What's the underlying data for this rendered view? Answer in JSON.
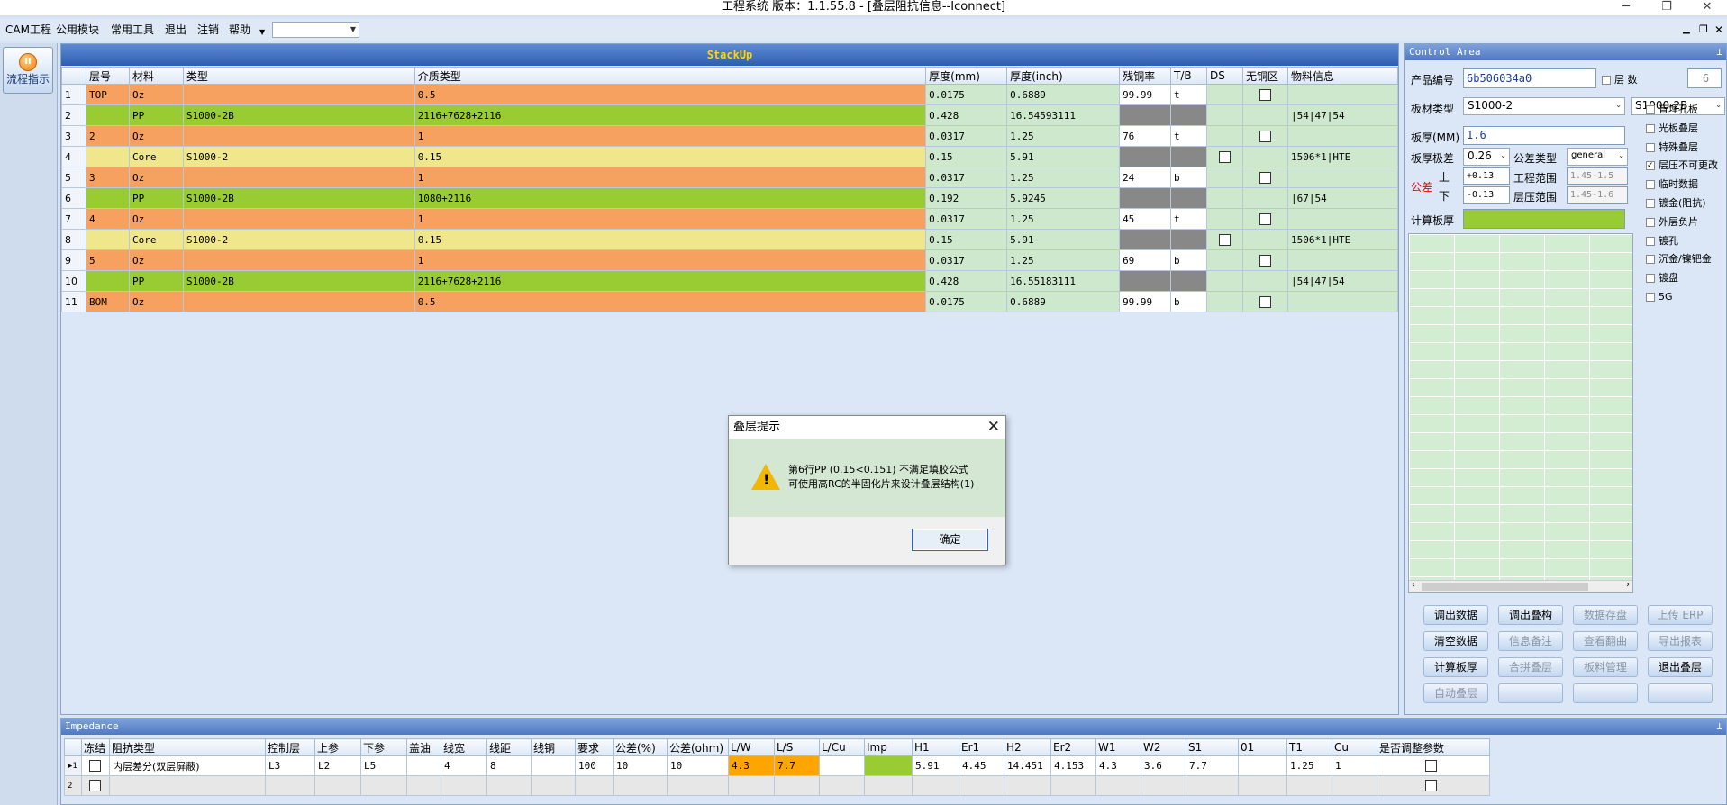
{
  "window": {
    "title": "工程系统   版本：1.1.55.8 - [叠层阻抗信息--Iconnect]"
  },
  "menu": {
    "items": [
      "CAM工程",
      "公用模块",
      "常用工具",
      "退出",
      "注销",
      "帮助"
    ],
    "combo_value": ""
  },
  "left": {
    "flow_label": "流程指示"
  },
  "stackup": {
    "title": "StackUp",
    "headers": [
      "层号",
      "材料",
      "类型",
      "介质类型",
      "厚度(mm)",
      "厚度(inch)",
      "残铜率",
      "T/B",
      "DS",
      "无铜区",
      "物料信息"
    ],
    "rows": [
      {
        "n": "1",
        "layer": "TOP",
        "mat": "Oz",
        "type": "",
        "dielectric": "0.5",
        "mm": "0.0175",
        "inch": "0.6889",
        "cu": "99.99",
        "tb": "t",
        "info": ""
      },
      {
        "n": "2",
        "layer": "",
        "mat": "PP",
        "type": "S1000-2B",
        "dielectric": "2116+7628+2116",
        "mm": "0.428",
        "inch": "16.54593111",
        "cu": "",
        "tb": "",
        "info": "|54|47|54"
      },
      {
        "n": "3",
        "layer": "2",
        "mat": "Oz",
        "type": "",
        "dielectric": "1",
        "mm": "0.0317",
        "inch": "1.25",
        "cu": "76",
        "tb": "t",
        "info": ""
      },
      {
        "n": "4",
        "layer": "",
        "mat": "Core",
        "type": "S1000-2",
        "dielectric": "0.15",
        "mm": "0.15",
        "inch": "5.91",
        "cu": "",
        "tb": "",
        "info": "1506*1|HTE"
      },
      {
        "n": "5",
        "layer": "3",
        "mat": "Oz",
        "type": "",
        "dielectric": "1",
        "mm": "0.0317",
        "inch": "1.25",
        "cu": "24",
        "tb": "b",
        "info": ""
      },
      {
        "n": "6",
        "layer": "",
        "mat": "PP",
        "type": "S1000-2B",
        "dielectric": "1080+2116",
        "mm": "0.192",
        "inch": "5.9245",
        "cu": "",
        "tb": "",
        "info": "|67|54"
      },
      {
        "n": "7",
        "layer": "4",
        "mat": "Oz",
        "type": "",
        "dielectric": "1",
        "mm": "0.0317",
        "inch": "1.25",
        "cu": "45",
        "tb": "t",
        "info": ""
      },
      {
        "n": "8",
        "layer": "",
        "mat": "Core",
        "type": "S1000-2",
        "dielectric": "0.15",
        "mm": "0.15",
        "inch": "5.91",
        "cu": "",
        "tb": "",
        "info": "1506*1|HTE"
      },
      {
        "n": "9",
        "layer": "5",
        "mat": "Oz",
        "type": "",
        "dielectric": "1",
        "mm": "0.0317",
        "inch": "1.25",
        "cu": "69",
        "tb": "b",
        "info": ""
      },
      {
        "n": "10",
        "layer": "",
        "mat": "PP",
        "type": "S1000-2B",
        "dielectric": "2116+7628+2116",
        "mm": "0.428",
        "inch": "16.55183111",
        "cu": "",
        "tb": "",
        "info": "|54|47|54"
      },
      {
        "n": "11",
        "layer": "BOM",
        "mat": "Oz",
        "type": "",
        "dielectric": "0.5",
        "mm": "0.0175",
        "inch": "0.6889",
        "cu": "99.99",
        "tb": "b",
        "info": ""
      }
    ]
  },
  "dialog": {
    "title": "叠层提示",
    "line1": "第6行PP (0.15<0.151) 不满足填胶公式",
    "line2": "可使用高RC的半固化片来设计叠层结构(1)",
    "ok": "确定"
  },
  "control": {
    "title": "Control Area",
    "product_label": "产品编号",
    "product_value": "6b506034a0",
    "layers_label": "层  数",
    "layers_value": "6",
    "board_type_label": "板材类型",
    "board_type_value": "S1000-2",
    "board_type_value2": "S1000-2B",
    "thickness_label": "板厚(MM)",
    "thickness_value": "1.6",
    "tol_label": "板厚极差",
    "tol_value": "0.26",
    "tol_type_label": "公差类型",
    "tol_type_value": "general",
    "gongcha_label": "公差",
    "up_label": "上",
    "down_label": "下",
    "up_value": "+0.13",
    "down_value": "-0.13",
    "eng_range_label": "工程范围",
    "eng_range_value": "1.45-1.5",
    "press_range_label": "层压范围",
    "press_range_value": "1.45-1.6",
    "calc_label": "计算板厚",
    "checkboxes": [
      "盲埋孔板",
      "光板叠层",
      "特殊叠层",
      "层压不可更改",
      "临时数据",
      "镀金(阻抗)",
      "外层负片",
      "镀孔",
      "沉金/镍钯金",
      "镀盘",
      "5G"
    ],
    "buttons": [
      "调出数据",
      "调出叠构",
      "数据存盘",
      "上传 ERP",
      "清空数据",
      "信息备注",
      "查看翻曲",
      "导出报表",
      "计算板厚",
      "合拼叠层",
      "板料管理",
      "退出叠层",
      "自动叠层",
      "",
      "",
      ""
    ]
  },
  "impedance": {
    "title": "Impedance",
    "headers": [
      "冻结",
      "阻抗类型",
      "控制层",
      "上参",
      "下参",
      "盖油",
      "线宽",
      "线距",
      "线铜",
      "要求",
      "公差(%)",
      "公差(ohm)",
      "L/W",
      "L/S",
      "L/Cu",
      "Imp",
      "H1",
      "Er1",
      "H2",
      "Er2",
      "W1",
      "W2",
      "S1",
      "01",
      "T1",
      "Cu",
      "是否调整参数"
    ],
    "row1": [
      "",
      "内层差分(双层屏蔽)",
      "L3",
      "L2",
      "L5",
      "",
      "4",
      "8",
      "",
      "100",
      "10",
      "10",
      "4.3",
      "7.7",
      "",
      "",
      "5.91",
      "4.45",
      "14.451",
      "4.153",
      "4.3",
      "3.6",
      "7.7",
      "",
      "1.25",
      "1",
      ""
    ],
    "row1_marker": "▶1",
    "row2_marker": "2"
  }
}
